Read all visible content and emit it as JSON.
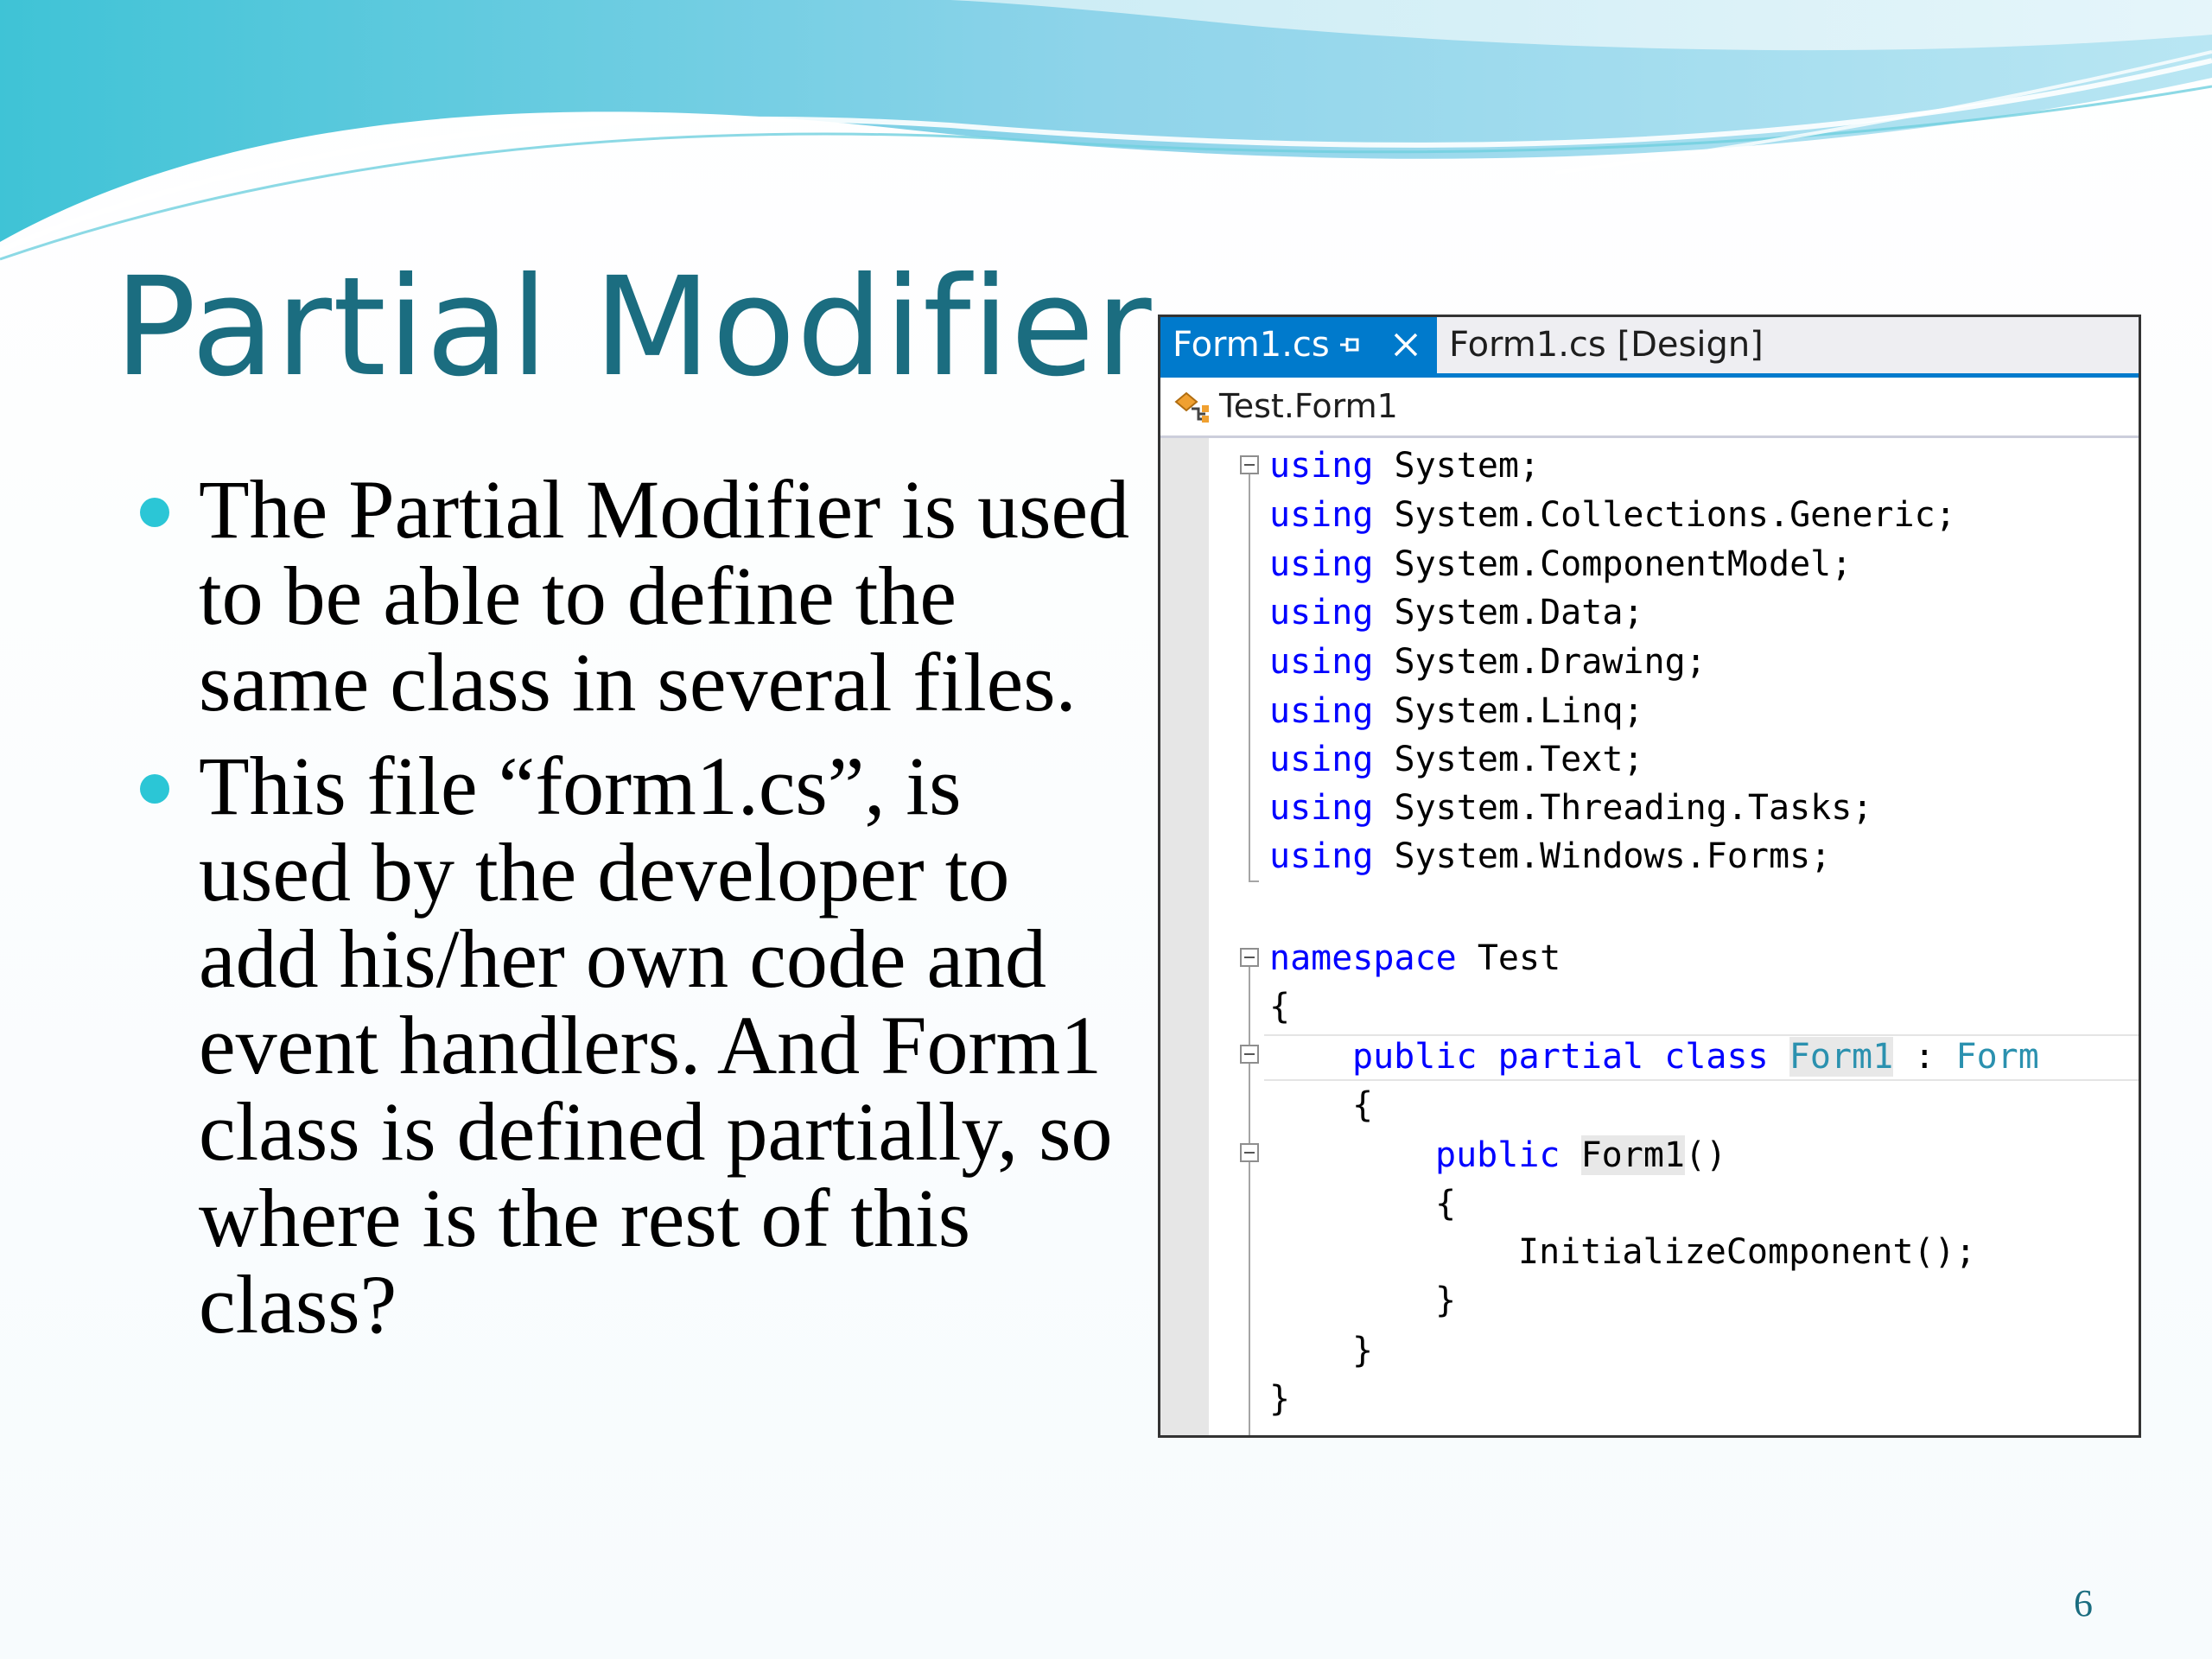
{
  "slide": {
    "title": "Partial Modifier",
    "bullets": [
      "The Partial Modifier is used to be able to define the same class in several files.",
      "This file “form1.cs”, is used by the developer to add his/her own code and event handlers. And Form1 class is defined partially, so where is the rest of this class?"
    ],
    "page_number": "6"
  },
  "editor": {
    "active_tab": "Form1.cs",
    "inactive_tab": "Form1.cs [Design]",
    "nav_path": "Test.Form1",
    "code": {
      "using_kw": "using",
      "usings": [
        "System;",
        "System.Collections.Generic;",
        "System.ComponentModel;",
        "System.Data;",
        "System.Drawing;",
        "System.Linq;",
        "System.Text;",
        "System.Threading.Tasks;",
        "System.Windows.Forms;"
      ],
      "namespace_kw": "namespace",
      "namespace_name": "Test",
      "open_brace": "{",
      "close_brace": "}",
      "public_kw": "public",
      "partial_kw": "partial",
      "class_kw": "class",
      "class_name": "Form1",
      "colon": ":",
      "base_type": "Form",
      "ctor_name": "Form1",
      "ctor_parens": "()",
      "ctor_body": "InitializeComponent();"
    }
  },
  "colors": {
    "title": "#1b6d80",
    "bullet": "#2bc6d6",
    "keyword": "#0000ff",
    "type": "#2b91af",
    "tab_active": "#007acc"
  }
}
